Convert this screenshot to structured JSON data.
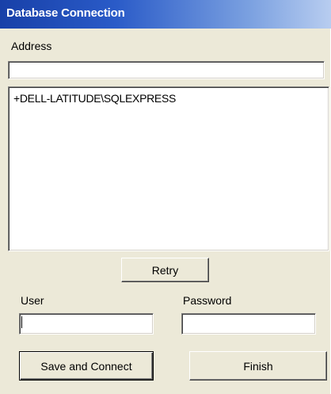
{
  "window": {
    "title": "Database Connection"
  },
  "address": {
    "label": "Address",
    "value": ""
  },
  "servers": {
    "items": [
      "+DELL-LATITUDE\\SQLEXPRESS"
    ]
  },
  "buttons": {
    "retry_label": "Retry",
    "save_connect_label": "Save and Connect",
    "finish_label": "Finish"
  },
  "user": {
    "label": "User",
    "value": ""
  },
  "password": {
    "label": "Password",
    "value": ""
  },
  "colors": {
    "title_bar_start": "#1840a8",
    "title_bar_end": "#b8cdf0",
    "dialog_background": "#ece9d8"
  }
}
